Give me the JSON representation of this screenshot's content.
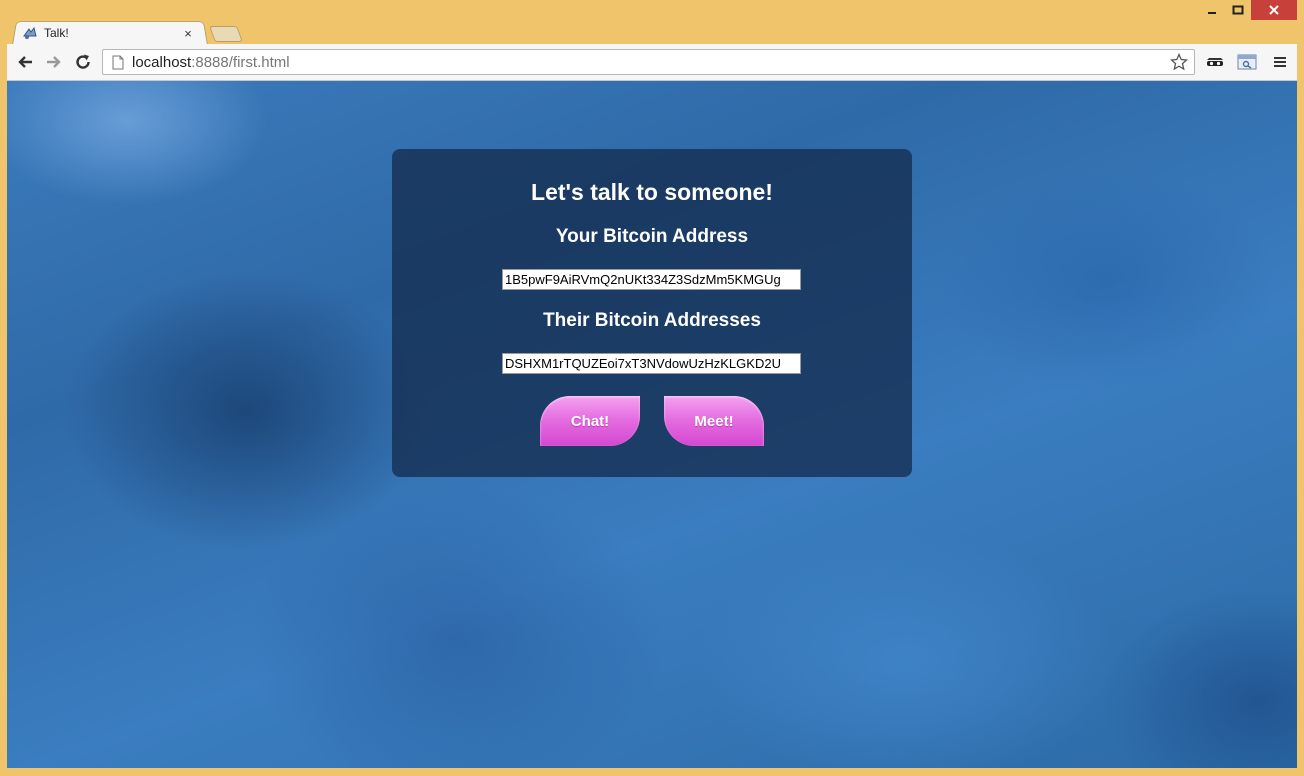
{
  "browser": {
    "tab_title": "Talk!",
    "tab_close": "×",
    "url_host": "localhost",
    "url_rest": ":8888/first.html"
  },
  "page": {
    "heading": "Let's talk to someone!",
    "your_address_label": "Your Bitcoin Address",
    "your_address_value": "1B5pwF9AiRVmQ2nUKt334Z3SdzMm5KMGUg",
    "their_address_label": "Their Bitcoin Addresses",
    "their_address_value": "DSHXM1rTQUZEoi7xT3NVdowUzHzKLGKD2U",
    "chat_button": "Chat!",
    "meet_button": "Meet!"
  },
  "colors": {
    "window_frame": "#f0c46a",
    "close_button": "#c7413a",
    "button_pink": "#e56fe0",
    "panel": "#142d50"
  },
  "icons": [
    "favicon-icon",
    "close-icon",
    "back-icon",
    "forward-icon",
    "reload-icon",
    "page-icon",
    "star-icon",
    "incognito-mask-icon",
    "extension-icon",
    "menu-icon",
    "minimize-icon",
    "maximize-icon"
  ]
}
